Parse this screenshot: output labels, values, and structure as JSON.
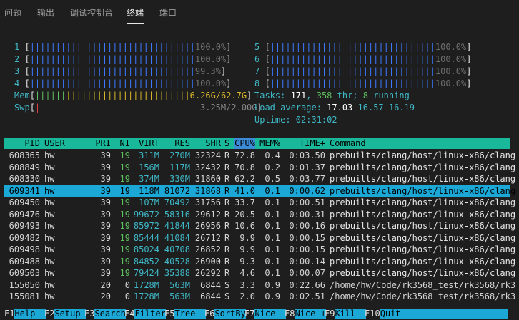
{
  "tabs": [
    {
      "label": "问题",
      "active": false
    },
    {
      "label": "输出",
      "active": false
    },
    {
      "label": "调试控制台",
      "active": false
    },
    {
      "label": "终端",
      "active": true
    },
    {
      "label": "端口",
      "active": false
    }
  ],
  "cpus_left": [
    {
      "num": "1",
      "bar": "||||||||||||||||||||||||||||||||",
      "pct": "100.0%"
    },
    {
      "num": "2",
      "bar": "||||||||||||||||||||||||||||||||",
      "pct": "100.0%"
    },
    {
      "num": "3",
      "bar": "||||||||||||||||||||||||||||||||",
      "pct": "99.3%"
    },
    {
      "num": "4",
      "bar": "||||||||||||||||||||||||||||||||",
      "pct": "100.0%"
    }
  ],
  "cpus_right": [
    {
      "num": "5",
      "bar": "||||||||||||||||||||||||||||||||",
      "pct": "100.0%"
    },
    {
      "num": "6",
      "bar": "||||||||||||||||||||||||||||||||",
      "pct": "100.0%"
    },
    {
      "num": "7",
      "bar": "||||||||||||||||||||||||||||||||",
      "pct": "100.0%"
    },
    {
      "num": "8",
      "bar": "||||||||||||||||||||||||||||||||",
      "pct": "100.0%"
    }
  ],
  "mem": {
    "label": "Mem",
    "bar_green": "||||||",
    "bar_yellow": "||||||||||||||||||||||||",
    "value": "6.26G/62.7G"
  },
  "swp": {
    "label": "Swp",
    "bar": "|",
    "value": "3.25M/2.00G"
  },
  "tasks": {
    "label": "Tasks: ",
    "tasks": "171",
    "sep1": ", ",
    "thr": "358",
    "thr_lbl": " thr; ",
    "running": "8",
    "running_lbl": " running"
  },
  "load": {
    "label": "Load average: ",
    "l1": "17.03",
    "l5": "16.57",
    "l15": "16.19"
  },
  "uptime": {
    "label": "Uptime: ",
    "value": "02:31:02"
  },
  "header": {
    "pid": "PID",
    "user": "USER",
    "pri": "PRI",
    "ni": "NI",
    "virt": "VIRT",
    "res": "RES",
    "shr": "SHR",
    "s": "S",
    "cpu": "CPU%",
    "mem": "MEM%",
    "time": "TIME+",
    "cmd": "Command"
  },
  "processes": [
    {
      "pid": "608365",
      "user": "hw",
      "pri": "39",
      "ni": "19",
      "virt": "311M",
      "res": "270M",
      "shr": "32324",
      "s": "R",
      "cpu": "72.8",
      "mem": "0.4",
      "time": "0:03.50",
      "cmd": "prebuilts/clang/host/linux-x86/clang"
    },
    {
      "pid": "608849",
      "user": "hw",
      "pri": "39",
      "ni": "19",
      "virt": "156M",
      "res": "117M",
      "shr": "32432",
      "s": "R",
      "cpu": "70.8",
      "mem": "0.2",
      "time": "0:01.37",
      "cmd": "prebuilts/clang/host/linux-x86/clang"
    },
    {
      "pid": "608330",
      "user": "hw",
      "pri": "39",
      "ni": "19",
      "virt": "374M",
      "res": "330M",
      "shr": "31860",
      "s": "R",
      "cpu": "62.2",
      "mem": "0.5",
      "time": "0:03.77",
      "cmd": "prebuilts/clang/host/linux-x86/clang"
    },
    {
      "pid": "609341",
      "user": "hw",
      "pri": "39",
      "ni": "19",
      "virt": "118M",
      "res": "81072",
      "shr": "31868",
      "s": "R",
      "cpu": "41.0",
      "mem": "0.1",
      "time": "0:00.62",
      "cmd": "prebuilts/clang/host/linux-x86/clang",
      "selected": true
    },
    {
      "pid": "609450",
      "user": "hw",
      "pri": "39",
      "ni": "19",
      "virt": "107M",
      "res": "70492",
      "shr": "31756",
      "s": "R",
      "cpu": "33.7",
      "mem": "0.1",
      "time": "0:00.51",
      "cmd": "prebuilts/clang/host/linux-x86/clang"
    },
    {
      "pid": "609476",
      "user": "hw",
      "pri": "39",
      "ni": "19",
      "virt": "99672",
      "res": "58316",
      "shr": "29612",
      "s": "R",
      "cpu": "20.5",
      "mem": "0.1",
      "time": "0:00.31",
      "cmd": "prebuilts/clang/host/linux-x86/clang"
    },
    {
      "pid": "609493",
      "user": "hw",
      "pri": "39",
      "ni": "19",
      "virt": "85972",
      "res": "41844",
      "shr": "26956",
      "s": "R",
      "cpu": "10.6",
      "mem": "0.1",
      "time": "0:00.16",
      "cmd": "prebuilts/clang/host/linux-x86/clang"
    },
    {
      "pid": "609482",
      "user": "hw",
      "pri": "39",
      "ni": "19",
      "virt": "85444",
      "res": "41084",
      "shr": "26712",
      "s": "R",
      "cpu": "9.9",
      "mem": "0.1",
      "time": "0:00.15",
      "cmd": "prebuilts/clang/host/linux-x86/clang"
    },
    {
      "pid": "609498",
      "user": "hw",
      "pri": "39",
      "ni": "19",
      "virt": "85024",
      "res": "40708",
      "shr": "26852",
      "s": "R",
      "cpu": "9.9",
      "mem": "0.1",
      "time": "0:00.15",
      "cmd": "prebuilts/clang/host/linux-x86/clang"
    },
    {
      "pid": "609488",
      "user": "hw",
      "pri": "39",
      "ni": "19",
      "virt": "84852",
      "res": "40528",
      "shr": "26900",
      "s": "R",
      "cpu": "9.3",
      "mem": "0.1",
      "time": "0:00.14",
      "cmd": "prebuilts/clang/host/linux-x86/clang"
    },
    {
      "pid": "609503",
      "user": "hw",
      "pri": "39",
      "ni": "19",
      "virt": "79424",
      "res": "35388",
      "shr": "26292",
      "s": "R",
      "cpu": "4.6",
      "mem": "0.1",
      "time": "0:00.07",
      "cmd": "prebuilts/clang/host/linux-x86/clang"
    },
    {
      "pid": "155050",
      "user": "hw",
      "pri": "20",
      "ni": "0",
      "virt": "1728M",
      "res": "563M",
      "shr": "6844",
      "s": "S",
      "cpu": "3.3",
      "mem": "0.9",
      "time": "0:22.66",
      "cmd": "/home/hw/Code/rk3568_test/rk3568/rk3"
    },
    {
      "pid": "155081",
      "user": "hw",
      "pri": "20",
      "ni": "0",
      "virt": "1728M",
      "res": "563M",
      "shr": "6844",
      "s": "S",
      "cpu": "2.0",
      "mem": "0.9",
      "time": "0:02.51",
      "cmd": "/home/hw/Code/rk3568_test/rk3568/rk3"
    }
  ],
  "fkeys": [
    {
      "key": "F1",
      "label": "Help  "
    },
    {
      "key": "F2",
      "label": "Setup "
    },
    {
      "key": "F3",
      "label": "Search"
    },
    {
      "key": "F4",
      "label": "Filter"
    },
    {
      "key": "F5",
      "label": "Tree  "
    },
    {
      "key": "F6",
      "label": "SortBy"
    },
    {
      "key": "F7",
      "label": "Nice -"
    },
    {
      "key": "F8",
      "label": "Nice +"
    },
    {
      "key": "F9",
      "label": "Kill  "
    },
    {
      "key": "F10",
      "label": "Quit"
    }
  ]
}
